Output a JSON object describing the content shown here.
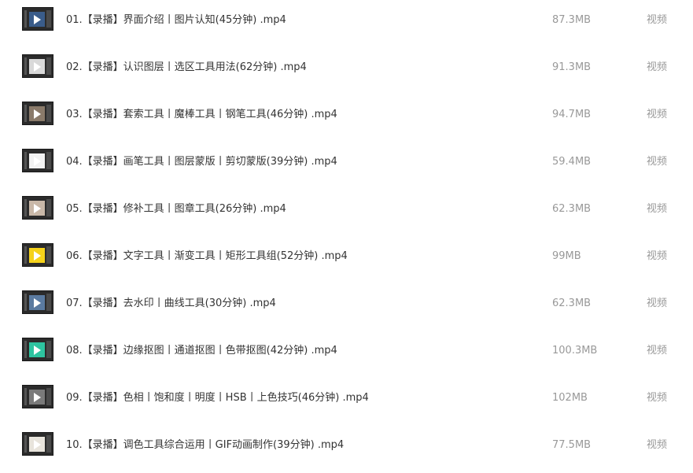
{
  "files": [
    {
      "name": "01.【录播】界面介绍丨图片认知(45分钟) .mp4",
      "size": "87.3MB",
      "type": "视频",
      "thumb_color": "#3a5c8a"
    },
    {
      "name": "02.【录播】认识图层丨选区工具用法(62分钟) .mp4",
      "size": "91.3MB",
      "type": "视频",
      "thumb_color": "#d9d9d9"
    },
    {
      "name": "03.【录播】套索工具丨魔棒工具丨钢笔工具(46分钟) .mp4",
      "size": "94.7MB",
      "type": "视频",
      "thumb_color": "#8a7a6a"
    },
    {
      "name": "04.【录播】画笔工具丨图层蒙版丨剪切蒙版(39分钟) .mp4",
      "size": "59.4MB",
      "type": "视频",
      "thumb_color": "#f2f2f2"
    },
    {
      "name": "05.【录播】修补工具丨图章工具(26分钟) .mp4",
      "size": "62.3MB",
      "type": "视频",
      "thumb_color": "#c9b8a8"
    },
    {
      "name": "06.【录播】文字工具丨渐变工具丨矩形工具组(52分钟) .mp4",
      "size": "99MB",
      "type": "视频",
      "thumb_color": "#f5d21a"
    },
    {
      "name": "07.【录播】去水印丨曲线工具(30分钟) .mp4",
      "size": "62.3MB",
      "type": "视频",
      "thumb_color": "#5a7aa0"
    },
    {
      "name": "08.【录播】边缘抠图丨通道抠图丨色带抠图(42分钟) .mp4",
      "size": "100.3MB",
      "type": "视频",
      "thumb_color": "#2ec4a0"
    },
    {
      "name": "09.【录播】色相丨饱和度丨明度丨HSB丨上色技巧(46分钟) .mp4",
      "size": "102MB",
      "type": "视频",
      "thumb_color": "#7a7a7a"
    },
    {
      "name": "10.【录播】调色工具综合运用丨GIF动画制作(39分钟) .mp4",
      "size": "77.5MB",
      "type": "视频",
      "thumb_color": "#e8e4dc"
    }
  ]
}
